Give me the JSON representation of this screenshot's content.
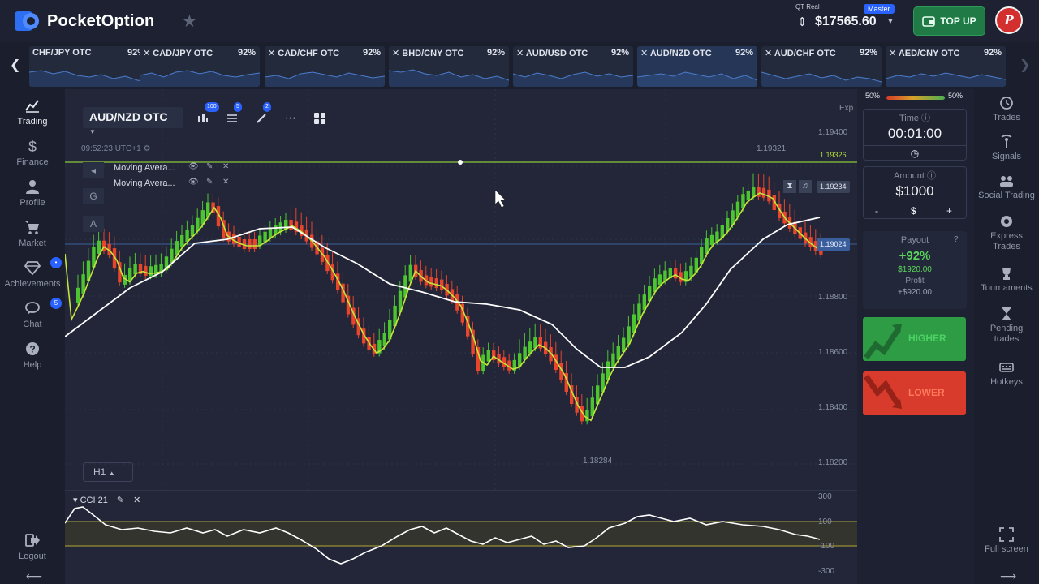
{
  "header": {
    "brand": "PocketOption",
    "account_type": "QT Real",
    "account_badge": "Master",
    "balance": "$17565.60",
    "topup_label": "TOP UP",
    "avatar_initials": "P"
  },
  "pairs": [
    {
      "name": "CHF/JPY OTC",
      "payout": "92%",
      "closable": false,
      "active": false
    },
    {
      "name": "CAD/JPY OTC",
      "payout": "92%",
      "closable": true,
      "active": false
    },
    {
      "name": "CAD/CHF OTC",
      "payout": "92%",
      "closable": true,
      "active": false
    },
    {
      "name": "BHD/CNY OTC",
      "payout": "92%",
      "closable": true,
      "active": false
    },
    {
      "name": "AUD/USD OTC",
      "payout": "92%",
      "closable": true,
      "active": false
    },
    {
      "name": "AUD/NZD OTC",
      "payout": "92%",
      "closable": true,
      "active": true
    },
    {
      "name": "AUD/CHF OTC",
      "payout": "92%",
      "closable": true,
      "active": false
    },
    {
      "name": "AED/CNY OTC",
      "payout": "92%",
      "closable": true,
      "active": false
    }
  ],
  "left_nav": [
    {
      "label": "Trading",
      "icon": "chart-line-icon",
      "active": true,
      "badge": ""
    },
    {
      "label": "Finance",
      "icon": "dollar-icon",
      "active": false,
      "badge": ""
    },
    {
      "label": "Profile",
      "icon": "user-icon",
      "active": false,
      "badge": ""
    },
    {
      "label": "Market",
      "icon": "cart-icon",
      "active": false,
      "badge": ""
    },
    {
      "label": "Achievements",
      "icon": "diamond-icon",
      "active": false,
      "badge": "•"
    },
    {
      "label": "Chat",
      "icon": "chat-icon",
      "active": false,
      "badge": "5"
    },
    {
      "label": "Help",
      "icon": "help-icon",
      "active": false,
      "badge": ""
    },
    {
      "label": "Logout",
      "icon": "logout-icon",
      "active": false,
      "badge": ""
    }
  ],
  "chart": {
    "asset": "AUD/NZD OTC",
    "toolbar_badges": {
      "indicators": "100",
      "settings": "5",
      "drawings": "2"
    },
    "server_time": "09:52:23 UTC+1",
    "indicators": [
      {
        "name": "Moving Avera..."
      },
      {
        "name": "Moving Avera..."
      }
    ],
    "timeframe": "H1",
    "price_ticks": [
      "1.19400",
      "1.18800",
      "1.18600",
      "1.18400",
      "1.18200"
    ],
    "high_label": "1.19321",
    "low_label": "1.18284",
    "green_line_tag": "1.19326",
    "current_price_tag": "1.19234",
    "blue_price_tag": "1.19024",
    "exp_label": "Exp",
    "cci": {
      "title": "CCI 21",
      "ticks": [
        "300",
        "100",
        "-100",
        "-300"
      ]
    },
    "colors": {
      "up": "#4cc531",
      "down": "#e8452c",
      "ma_fast": "#c7e43a",
      "ma_slow": "#ffffff"
    }
  },
  "trade": {
    "sentiment_left": "50%",
    "sentiment_right": "50%",
    "time_label": "Time",
    "time_value": "00:01:00",
    "amount_label": "Amount",
    "amount_value": "$1000",
    "minus": "-",
    "currency": "$",
    "plus": "+",
    "payout_label": "Payout",
    "payout_pct": "+92%",
    "payout_amount": "$1920.00",
    "profit_label": "Profit",
    "profit_amount": "+$920.00",
    "higher_label": "HIGHER",
    "lower_label": "LOWER"
  },
  "right_nav": [
    {
      "label": "Trades",
      "icon": "history-icon"
    },
    {
      "label": "Signals",
      "icon": "signal-icon"
    },
    {
      "label": "Social Trading",
      "icon": "social-icon"
    },
    {
      "label": "Express Trades",
      "icon": "express-icon"
    },
    {
      "label": "Tournaments",
      "icon": "trophy-icon"
    },
    {
      "label": "Pending trades",
      "icon": "hourglass-icon"
    },
    {
      "label": "Hotkeys",
      "icon": "keyboard-icon"
    },
    {
      "label": "Full screen",
      "icon": "fullscreen-icon"
    }
  ]
}
